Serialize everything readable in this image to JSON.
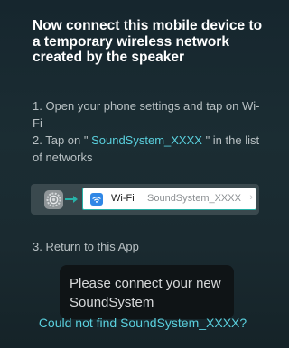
{
  "heading": "Now connect this mobile device to a temporary wireless network created by the speaker",
  "steps": {
    "step1": "1. Open your phone settings and tap on Wi-Fi",
    "step2_prefix": "2. Tap on \" ",
    "step2_network": "SoundSystem_XXXX",
    "step2_suffix": " \" in the list of networks",
    "step3": "3. Return to this App"
  },
  "illustration": {
    "settings_icon": "settings-gear-icon",
    "wifi_icon": "wifi-icon",
    "wifi_label": "Wi-Fi",
    "network_name": "SoundSystem_XXXX",
    "chevron": "›"
  },
  "toast": {
    "message": "Please connect your new SoundSystem"
  },
  "help_link": "Could not find SoundSystem_XXXX?",
  "colors": {
    "accent": "#5ad0de",
    "wifi_blue": "#2f87e6",
    "highlight_border": "#27b2a8"
  }
}
